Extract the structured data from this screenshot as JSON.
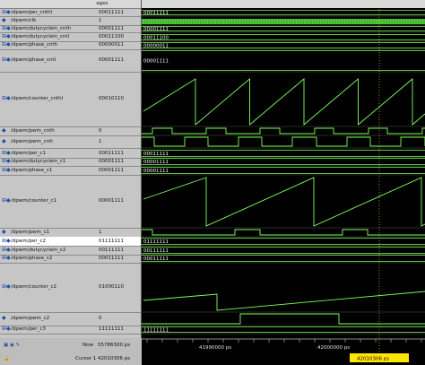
{
  "header": {
    "messages_label": "Messages"
  },
  "signals": [
    {
      "name": "/dpwm/per_cnthl",
      "value": "00011111",
      "expand": true
    },
    {
      "name": "/dpwm/clk",
      "value": "1",
      "expand": false
    },
    {
      "name": "/dpwm/dutycyclein_cnth",
      "value": "00001111",
      "expand": true
    },
    {
      "name": "/dpwm/dutycyclein_cntl",
      "value": "00011100",
      "expand": true
    },
    {
      "name": "/dpwm/phase_cnth",
      "value": "00000011",
      "expand": true
    },
    {
      "name": "/dpwm/phase_cntl",
      "value": "00001111",
      "expand": true
    },
    {
      "name": "/dpwm/counter_cnthl",
      "value": "00010110",
      "expand": true
    },
    {
      "name": "/dpwm/pwm_cnth",
      "value": "0",
      "expand": false
    },
    {
      "name": "/dpwm/pwm_cntl",
      "value": "1",
      "expand": false
    },
    {
      "name": "/dpwm/per_c1",
      "value": "00011111",
      "expand": true
    },
    {
      "name": "/dpwm/dutycyclein_c1",
      "value": "00001111",
      "expand": true
    },
    {
      "name": "/dpwm/phase_c1",
      "value": "00001111",
      "expand": true
    },
    {
      "name": "/dpwm/counter_c1",
      "value": "00001111",
      "expand": true
    },
    {
      "name": "/dpwm/pwm_c1",
      "value": "1",
      "expand": false
    },
    {
      "name": "/dpwm/per_c2",
      "value": "01111111",
      "expand": true,
      "selected": true
    },
    {
      "name": "/dpwm/dutycyclein_c2",
      "value": "00111111",
      "expand": true
    },
    {
      "name": "/dpwm/phase_c2",
      "value": "00011111",
      "expand": true
    },
    {
      "name": "/dpwm/counter_c2",
      "value": "01000110",
      "expand": true
    },
    {
      "name": "/dpwm/pwm_c2",
      "value": "0",
      "expand": false
    },
    {
      "name": "/dpwm/per_c3",
      "value": "11111111",
      "expand": true
    }
  ],
  "wave_labels": {
    "per_cnthl": "00011111",
    "dutycyclein_cnth": "00001111",
    "dutycyclein_cntl": "00011100",
    "phase_cnth": "00000011",
    "phase_cntl": "00001111",
    "per_c1": "00011111",
    "dutycyclein_c1": "00001111",
    "phase_c1": "00001111",
    "per_c2": "01111111",
    "dutycyclein_c2": "00111111",
    "phase_c2": "00011111",
    "per_c3": "11111111"
  },
  "footer": {
    "now_label": "Now",
    "now_value": "55786300 ps",
    "cursor_label": "Cursor 1",
    "cursor_value": "42010306 ps",
    "time_ticks": [
      "41990000 ps",
      "42000000 ps"
    ],
    "cursor_marker": "42010306 ps"
  },
  "colors": {
    "wave": "#7fff5a",
    "background": "#000000",
    "panel": "#c6c6c6",
    "cursor": "#ffe600"
  }
}
